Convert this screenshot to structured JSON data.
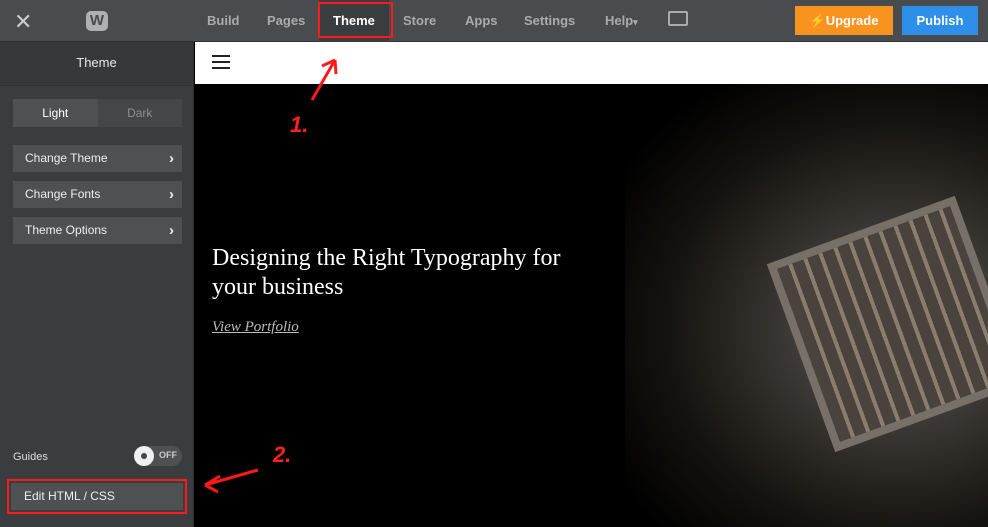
{
  "topbar": {
    "close": "✕",
    "logo": "W",
    "nav": [
      "Build",
      "Pages",
      "Theme",
      "Store",
      "Apps",
      "Settings",
      "Help"
    ],
    "help_caret": "▾",
    "upgrade": "Upgrade",
    "publish": "Publish"
  },
  "sidebar": {
    "title": "Theme",
    "light": "Light",
    "dark": "Dark",
    "items": [
      "Change Theme",
      "Change Fonts",
      "Theme Options"
    ],
    "guides": "Guides",
    "toggle": "OFF",
    "edit": "Edit HTML / CSS"
  },
  "hero": {
    "heading": "Designing the Right Typography for your business",
    "link": "View Portfolio"
  },
  "annotations": {
    "one": "1.",
    "two": "2."
  },
  "colors": {
    "upgrade": "#f7931e",
    "publish": "#2d8fe8",
    "highlight": "#ff1a1a"
  }
}
